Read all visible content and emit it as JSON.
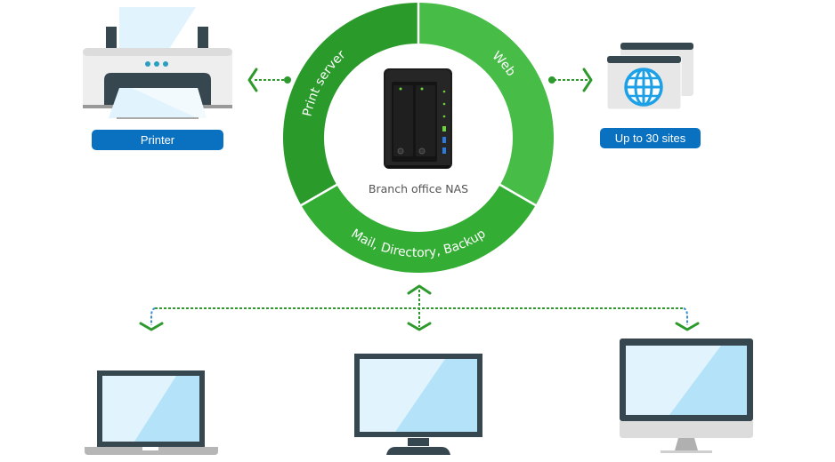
{
  "diagram": {
    "center": {
      "label": "Branch office NAS",
      "icon": "nas-device-icon"
    },
    "ring_segments": [
      {
        "label": "Print server",
        "color": "#2a9a2a"
      },
      {
        "label": "Web",
        "color": "#47bc47"
      },
      {
        "label": "Mail, Directory, Backup",
        "color": "#33ad33"
      }
    ],
    "left_target": {
      "label": "Printer",
      "icon": "printer-icon"
    },
    "right_target": {
      "label": "Up to 30 sites",
      "icon": "website-globe-icon"
    },
    "clients": [
      {
        "icon": "laptop-icon"
      },
      {
        "icon": "monitor-icon"
      },
      {
        "icon": "desktop-computer-icon"
      }
    ],
    "colors": {
      "label_bg": "#0a71c0",
      "connector": "#2e9a2e",
      "connector_alt": "#3a8fd0",
      "device_frame": "#37474f",
      "screen_light": "#e1f3fd",
      "screen_dark": "#b3e2f9"
    }
  }
}
